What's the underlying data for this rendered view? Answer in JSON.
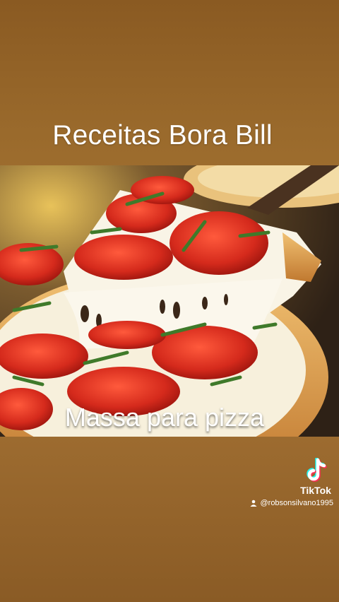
{
  "video": {
    "title": "Receitas Bora Bill",
    "caption": "Massa para pizza"
  },
  "watermark": {
    "brand": "TikTok",
    "brand_icon": "tiktok-logo-icon",
    "user_icon": "user-icon",
    "handle": "@robsonsilvano1995"
  },
  "colors": {
    "background": "#9a6a2c",
    "text": "#ffffff",
    "tiktok_cyan": "#25F4EE",
    "tiktok_red": "#FE2C55"
  }
}
